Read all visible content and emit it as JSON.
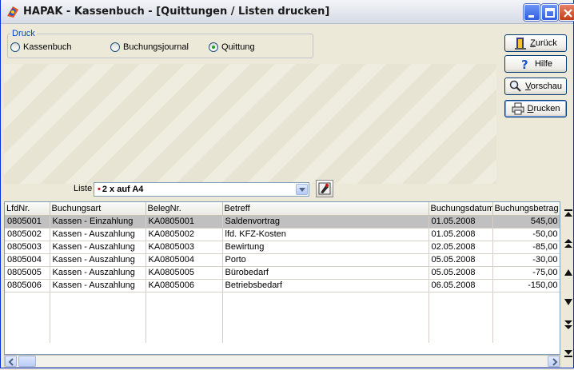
{
  "window": {
    "title": "HAPAK - Kassenbuch - [Quittungen / Listen drucken]"
  },
  "druck": {
    "legend": "Druck",
    "options": [
      {
        "label": "Kassenbuch",
        "checked": false
      },
      {
        "label": "Buchungsjournal",
        "checked": false
      },
      {
        "label": "Quittung",
        "checked": true
      }
    ]
  },
  "buttons": {
    "back": {
      "underline": "Z",
      "rest": "urück"
    },
    "help": {
      "label": "Hilfe"
    },
    "preview": {
      "underline": "V",
      "rest": "orschau"
    },
    "print": {
      "underline": "D",
      "rest": "rucken"
    }
  },
  "liste": {
    "label": "Liste",
    "mark": "•",
    "value": "2 x auf A4"
  },
  "table": {
    "columns": [
      "LfdNr.",
      "Buchungsart",
      "BelegNr.",
      "Betreff",
      "Buchungsdatum",
      "Buchungsbetrag"
    ],
    "rows": [
      [
        "0805001",
        "Kassen - Einzahlung",
        "KA0805001",
        "Saldenvortrag",
        "01.05.2008",
        "545,00"
      ],
      [
        "0805002",
        "Kassen - Auszahlung",
        "KA0805002",
        "lfd. KFZ-Kosten",
        "01.05.2008",
        "-50,00"
      ],
      [
        "0805003",
        "Kassen - Auszahlung",
        "KA0805003",
        "Bewirtung",
        "02.05.2008",
        "-85,00"
      ],
      [
        "0805004",
        "Kassen - Auszahlung",
        "KA0805004",
        "Porto",
        "05.05.2008",
        "-30,00"
      ],
      [
        "0805005",
        "Kassen - Auszahlung",
        "KA0805005",
        "Bürobedarf",
        "05.05.2008",
        "-75,00"
      ],
      [
        "0805006",
        "Kassen - Auszahlung",
        "KA0805006",
        "Betriebsbedarf",
        "06.05.2008",
        "-150,00"
      ]
    ],
    "selected_row": 0
  },
  "colors": {
    "accent": "#0046d5",
    "selection": "#c0c0c0",
    "window_border": "#0831d9"
  },
  "icons": [
    "app-logo-icon",
    "minimize-icon",
    "maximize-icon",
    "close-icon",
    "door-exit-icon",
    "question-icon",
    "magnifier-icon",
    "printer-icon",
    "tool-icon",
    "first-record-icon",
    "prev-page-icon",
    "prev-record-icon",
    "next-record-icon",
    "next-page-icon",
    "last-record-icon"
  ]
}
